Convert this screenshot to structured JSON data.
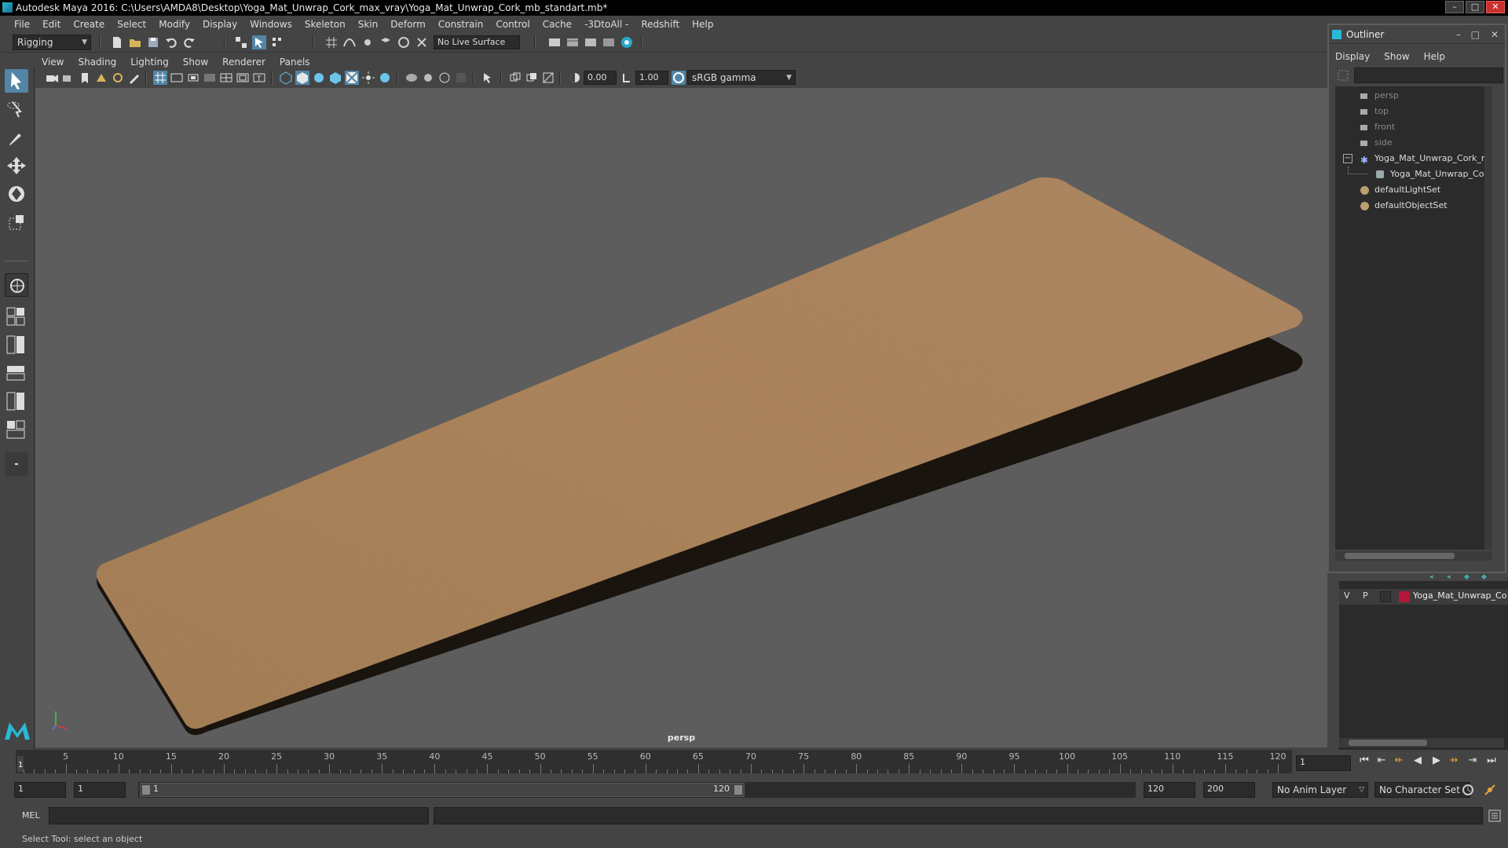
{
  "window": {
    "title": "Autodesk Maya 2016: C:\\Users\\AMDA8\\Desktop\\Yoga_Mat_Unwrap_Cork_max_vray\\Yoga_Mat_Unwrap_Cork_mb_standart.mb*"
  },
  "menubar": {
    "items": [
      "File",
      "Edit",
      "Create",
      "Select",
      "Modify",
      "Display",
      "Windows",
      "Skeleton",
      "Skin",
      "Deform",
      "Constrain",
      "Control",
      "Cache",
      "-3DtoAll -",
      "Redshift",
      "Help"
    ]
  },
  "statusline": {
    "mode": "Rigging",
    "live_surface": "No Live Surface"
  },
  "panel": {
    "menu": [
      "View",
      "Shading",
      "Lighting",
      "Show",
      "Renderer",
      "Panels"
    ],
    "exposure": "0.00",
    "gamma": "1.00",
    "colorspace": "sRGB gamma",
    "camera_label": "persp"
  },
  "outliner": {
    "title": "Outliner",
    "menu": [
      "Display",
      "Show",
      "Help"
    ],
    "items": [
      {
        "label": "persp",
        "icon": "camera-icon",
        "dim": true
      },
      {
        "label": "top",
        "icon": "camera-icon",
        "dim": true
      },
      {
        "label": "front",
        "icon": "camera-icon",
        "dim": true
      },
      {
        "label": "side",
        "icon": "camera-icon",
        "dim": true
      },
      {
        "label": "Yoga_Mat_Unwrap_Cork_r",
        "icon": "group-icon",
        "dim": false
      },
      {
        "label": "Yoga_Mat_Unwrap_Co",
        "icon": "mesh-icon",
        "dim": false
      },
      {
        "label": "defaultLightSet",
        "icon": "set-icon",
        "dim": false
      },
      {
        "label": "defaultObjectSet",
        "icon": "set-icon",
        "dim": false
      }
    ]
  },
  "layers": {
    "v": "V",
    "p": "P",
    "name": "Yoga_Mat_Unwrap_Co",
    "color": "#b3163a"
  },
  "timeline": {
    "ticks": [
      5,
      10,
      15,
      20,
      25,
      30,
      35,
      40,
      45,
      50,
      55,
      60,
      65,
      70,
      75,
      80,
      85,
      90,
      95,
      100,
      105,
      110,
      115,
      120
    ],
    "start_label": "1",
    "current_frame": "1"
  },
  "range": {
    "start": "1",
    "playback_start": "1",
    "slider_start": "1",
    "slider_end": "120",
    "playback_end": "120",
    "end": "200",
    "anim_layer": "No Anim Layer",
    "character_set": "No Character Set"
  },
  "cmdline": {
    "lang": "MEL"
  },
  "helpline": {
    "text": "Select Tool: select an object"
  },
  "colors": {
    "viewport_bg": "#5d5d5d",
    "cork": "#a77b52",
    "accent": "#5285a6"
  }
}
